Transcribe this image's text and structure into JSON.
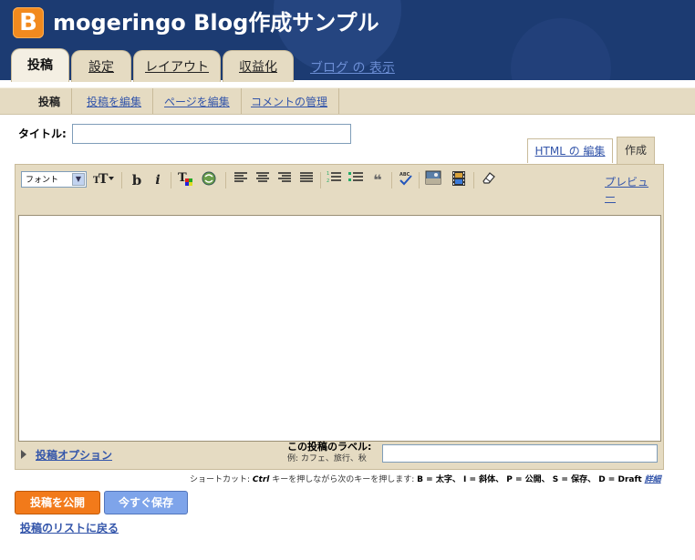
{
  "header": {
    "logo_letter": "B",
    "site_title": "mogeringo Blog作成サンプル",
    "view_blog_link": "ブログ の 表示"
  },
  "tabs": [
    {
      "label": "投稿",
      "active": true
    },
    {
      "label": "設定",
      "active": false
    },
    {
      "label": "レイアウト",
      "active": false
    },
    {
      "label": "収益化",
      "active": false
    }
  ],
  "subnav": [
    {
      "label": "投稿",
      "active": true
    },
    {
      "label": "投稿を編集",
      "active": false
    },
    {
      "label": "ページを編集",
      "active": false
    },
    {
      "label": "コメントの管理",
      "active": false
    }
  ],
  "post": {
    "title_label": "タイトル:",
    "title_value": ""
  },
  "editor": {
    "tab_html": "HTML の 編集",
    "tab_compose": "作成",
    "font_select_value": "フォント",
    "preview_link": "プレビュー",
    "toolbar_icons": [
      "font-size-icon",
      "bold-icon",
      "italic-icon",
      "text-color-icon",
      "link-icon",
      "align-left-icon",
      "align-center-icon",
      "align-right-icon",
      "align-justify-icon",
      "numbered-list-icon",
      "bullet-list-icon",
      "blockquote-icon",
      "spellcheck-icon",
      "image-icon",
      "video-icon",
      "remove-format-icon"
    ],
    "body_value": ""
  },
  "options": {
    "link_label": "投稿オプション",
    "labels_caption": "この投稿のラベル:",
    "labels_example": "例: カフェ、旅行、秋",
    "labels_value": ""
  },
  "shortcuts": {
    "prefix": "ショートカット:",
    "ctrl": "Ctrl",
    "middle": "キーを押しながら次のキーを押します:",
    "keys": "B = 太字、 I = 斜体、 P = 公開、 S = 保存、 D = Draft",
    "more": "詳細"
  },
  "actions": {
    "publish": "投稿を公開",
    "save_now": "今すぐ保存",
    "back_to_list": "投稿のリストに戻る"
  },
  "colors": {
    "header_bg": "#1c3b72",
    "tab_bg": "#e5dbc2",
    "publish_button": "#f27a1a",
    "save_button": "#7ea4ea",
    "link": "#3355aa"
  }
}
